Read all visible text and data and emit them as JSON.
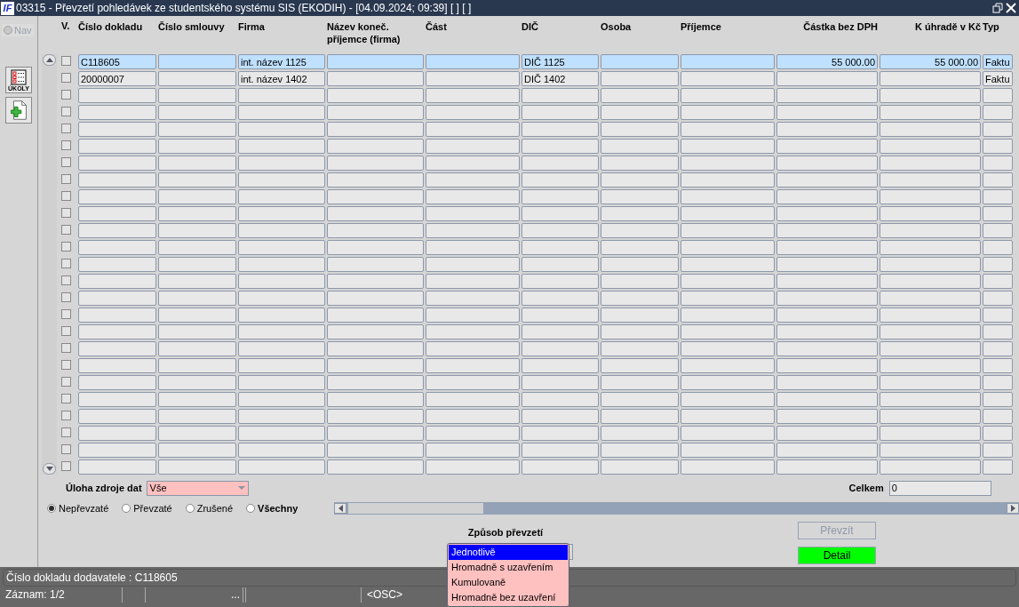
{
  "window": {
    "logo": "IF",
    "title": "03315 - Převzetí pohledávek ze studentského systému SIS (EKODIH) - [04.09.2024; 09:39]  [ ]  [ ]"
  },
  "sidebar": {
    "nav": {
      "label": "Nav",
      "disabled": true
    },
    "tasks_button": {
      "label": "ÚKOLY"
    }
  },
  "table": {
    "check_header": "V.",
    "columns": [
      {
        "label": "Číslo dokladu",
        "kind": "text"
      },
      {
        "label": "Číslo smlouvy",
        "kind": "text"
      },
      {
        "label": "Firma",
        "kind": "text"
      },
      {
        "label": "Název koneč. příjemce (firma)",
        "kind": "text"
      },
      {
        "label": "Část",
        "kind": "text"
      },
      {
        "label": "DIČ",
        "kind": "text"
      },
      {
        "label": "Osoba",
        "kind": "text"
      },
      {
        "label": "Příjemce",
        "kind": "text"
      },
      {
        "label": "Částka bez DPH",
        "kind": "amount"
      },
      {
        "label": "K úhradě v Kč",
        "kind": "amount"
      },
      {
        "label": "Typ",
        "kind": "text"
      }
    ],
    "rows": [
      {
        "selected": true,
        "checked": false,
        "cells": [
          "C118605",
          null,
          "int. název 1125",
          null,
          null,
          "DIČ 1125",
          null,
          null,
          "55 000.00",
          "55 000.00",
          "Faktu"
        ]
      },
      {
        "selected": false,
        "checked": false,
        "cells": [
          "20000007",
          null,
          "int. název 1402",
          null,
          null,
          "DIČ 1402",
          null,
          null,
          null,
          null,
          "Faktu"
        ]
      },
      {
        "selected": false,
        "checked": false
      },
      {
        "selected": false,
        "checked": false
      },
      {
        "selected": false,
        "checked": false
      },
      {
        "selected": false,
        "checked": false
      },
      {
        "selected": false,
        "checked": false
      },
      {
        "selected": false,
        "checked": false
      },
      {
        "selected": false,
        "checked": false
      },
      {
        "selected": false,
        "checked": false
      },
      {
        "selected": false,
        "checked": false
      },
      {
        "selected": false,
        "checked": false
      },
      {
        "selected": false,
        "checked": false
      },
      {
        "selected": false,
        "checked": false
      },
      {
        "selected": false,
        "checked": false
      },
      {
        "selected": false,
        "checked": false
      },
      {
        "selected": false,
        "checked": false
      },
      {
        "selected": false,
        "checked": false
      },
      {
        "selected": false,
        "checked": false
      },
      {
        "selected": false,
        "checked": false
      },
      {
        "selected": false,
        "checked": false
      },
      {
        "selected": false,
        "checked": false
      },
      {
        "selected": false,
        "checked": false
      },
      {
        "selected": false,
        "checked": false
      },
      {
        "selected": false,
        "checked": false
      }
    ]
  },
  "filter": {
    "label": "Úloha zdroje dat",
    "value": "Vše"
  },
  "total": {
    "label": "Celkem",
    "value": "0"
  },
  "status_filter": [
    {
      "label": "Nepřevzaté",
      "selected": true,
      "emphasized": false
    },
    {
      "label": "Převzaté",
      "selected": false,
      "emphasized": false
    },
    {
      "label": "Zrušené",
      "selected": false,
      "emphasized": false
    },
    {
      "label": "Všechny",
      "selected": false,
      "emphasized": true
    }
  ],
  "transfer_mode": {
    "label": "Způsob převzetí",
    "options": [
      {
        "label": "Jednotlivě",
        "selected": true
      },
      {
        "label": "Hromadně s uzavřením",
        "selected": false
      },
      {
        "label": "Kumulovaně",
        "selected": false
      },
      {
        "label": "Hromadně bez uzavření",
        "selected": false
      }
    ]
  },
  "buttons": [
    {
      "label": "Převzít",
      "disabled": true
    },
    {
      "label": "Detail",
      "disabled": false,
      "color": "#00ff00"
    }
  ],
  "status_bar": {
    "message": "Číslo dokladu dodavatele : C118605",
    "record": "Záznam: 1/2",
    "more": "...",
    "mode": "<OSC>"
  }
}
